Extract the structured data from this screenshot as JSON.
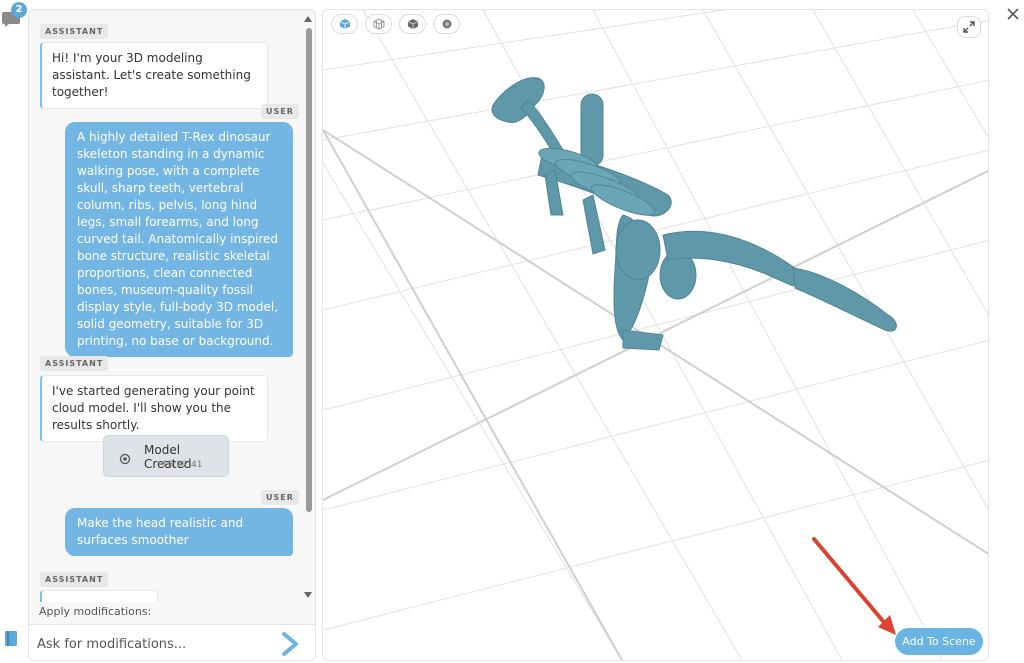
{
  "rail": {
    "chat_badge_count": "2"
  },
  "chat": {
    "messages": [
      {
        "role": "ASSISTANT",
        "text": "Hi! I'm your 3D modeling assistant. Let's create something together!"
      },
      {
        "role": "USER",
        "text": "A highly detailed T-Rex dinosaur skeleton standing in a dynamic walking pose, with a complete skull, sharp teeth, vertebral column, ribs, pelvis, long hind legs, small forearms, and long curved tail. Anatomically inspired bone structure, realistic skeletal proportions, clean connected bones, museum-quality fossil display style, full-body 3D model, solid geometry, suitable for 3D printing, no base or background."
      },
      {
        "role": "ASSISTANT",
        "text": "I've started generating your point cloud model. I'll show you the results shortly."
      },
      {
        "role": "USER",
        "text": "Make the head realistic and surfaces smoother"
      },
      {
        "role": "ASSISTANT",
        "text": ""
      }
    ],
    "model_card": {
      "title": "Model Created",
      "time": "15:02:41"
    },
    "apply_label": "Apply modifications:",
    "input_placeholder": "Ask for modifications..."
  },
  "viewport": {
    "toolbar": [
      "cube-solid-icon",
      "cube-wireframe-icon",
      "cube-shaded-icon",
      "cube-points-icon"
    ],
    "add_to_scene_label": "Add To Scene",
    "model_color": "#5f98a8",
    "accent_color": "#6ab4e4",
    "arrow_color": "#d9432f"
  }
}
